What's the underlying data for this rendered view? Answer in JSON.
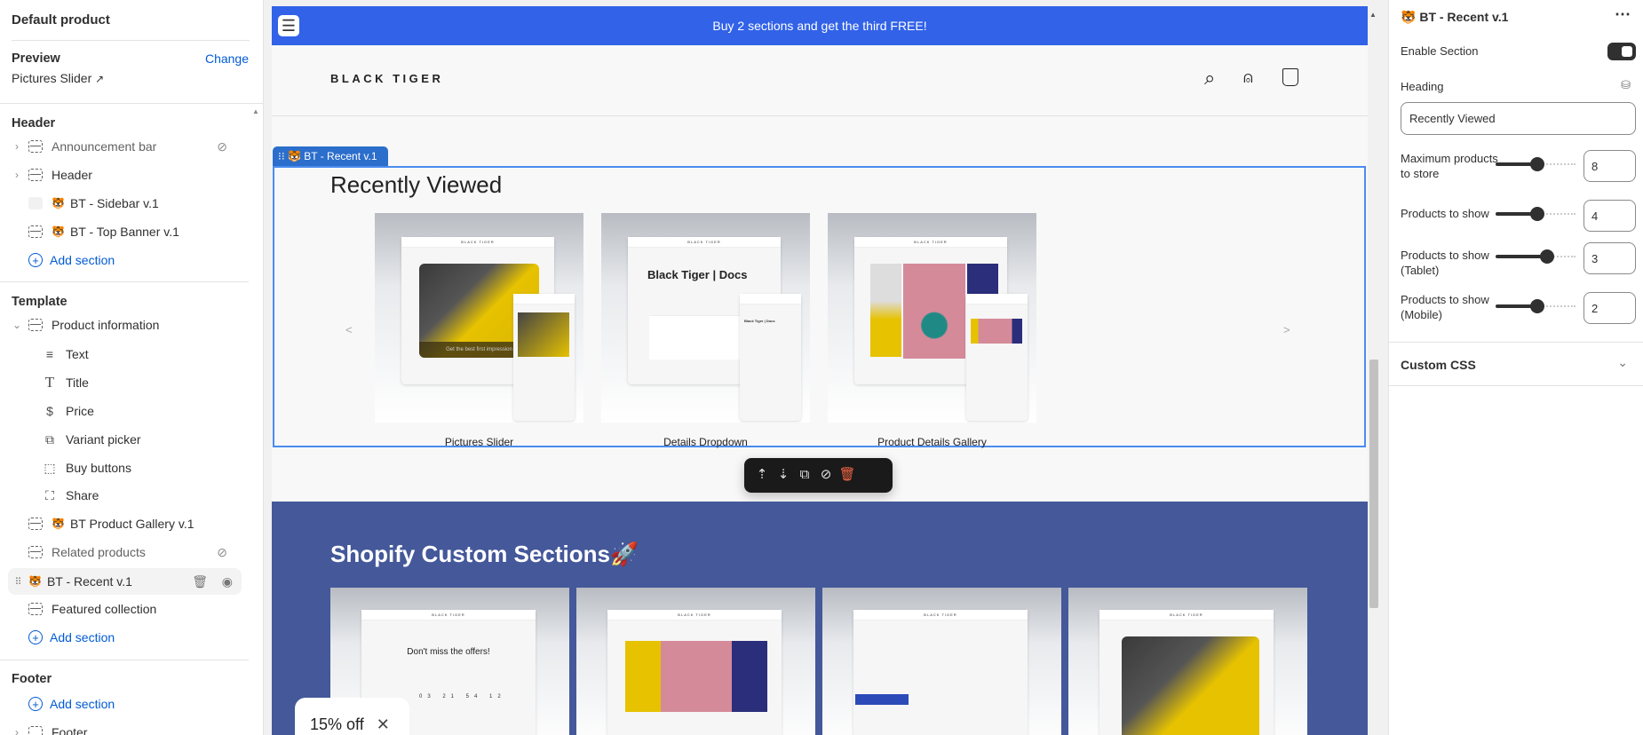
{
  "left": {
    "title": "Default product",
    "preview_label": "Preview",
    "change": "Change",
    "preview_value": "Pictures Slider",
    "header_group": "Header",
    "header_items": [
      {
        "label": "Announcement bar",
        "hidden": true
      },
      {
        "label": "Header"
      },
      {
        "label": "BT - Sidebar v.1"
      },
      {
        "label": "BT - Top Banner v.1"
      }
    ],
    "add_section": "Add section",
    "template_group": "Template",
    "product_info": "Product information",
    "blocks": [
      {
        "label": "Text",
        "icon": "text-icon"
      },
      {
        "label": "Title",
        "icon": "title-icon"
      },
      {
        "label": "Price",
        "icon": "price-tag-icon"
      },
      {
        "label": "Variant picker",
        "icon": "variant-icon"
      },
      {
        "label": "Buy buttons",
        "icon": "cursor-icon"
      },
      {
        "label": "Share",
        "icon": "share-icon"
      }
    ],
    "template_items": [
      {
        "label": "BT Product Gallery v.1"
      },
      {
        "label": "Related products",
        "hidden": true
      },
      {
        "label": "BT - Recent v.1",
        "selected": true
      },
      {
        "label": "Featured collection"
      }
    ],
    "footer_group": "Footer",
    "footer_item": "Footer"
  },
  "preview": {
    "announcement": "Buy 2 sections and get the third FREE!",
    "logo": "BLACK TIGER",
    "section_tag": "BT - Recent v.1",
    "heading": "Recently Viewed",
    "products": [
      {
        "name": "Pictures Slider",
        "mock_text": "Get the best first impression"
      },
      {
        "name": "Details Dropdown",
        "mock_text": "Black Tiger | Docs"
      },
      {
        "name": "Product Details Gallery",
        "mock_text": ""
      }
    ],
    "prev": "<",
    "next": ">",
    "custom_heading": "Shopify Custom Sections🚀",
    "custom_cards": [
      "Don't miss the offers!",
      "",
      "",
      ""
    ],
    "popup": "15% off",
    "accent": "#3162e8",
    "section_bg": "#44589a"
  },
  "right": {
    "title": "BT - Recent v.1",
    "enable_label": "Enable Section",
    "enabled": true,
    "heading_label": "Heading",
    "heading_value": "Recently Viewed",
    "max_label": "Maximum products to store",
    "max_value": "8",
    "show_label": "Products to show",
    "show_value": "4",
    "tablet_label": "Products to show (Tablet)",
    "tablet_value": "3",
    "mobile_label": "Products to show (Mobile)",
    "mobile_value": "2",
    "custom_css": "Custom CSS"
  }
}
